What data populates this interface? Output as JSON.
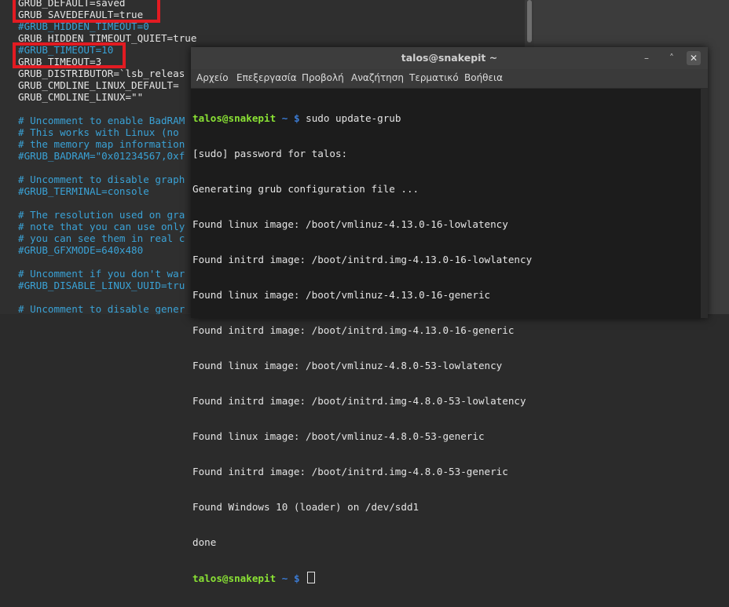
{
  "editor": {
    "lines": [
      {
        "text": "GRUB_DEFAULT=saved",
        "comment": false
      },
      {
        "text": "GRUB_SAVEDEFAULT=true",
        "comment": false
      },
      {
        "text": "#GRUB_HIDDEN_TIMEOUT=0",
        "comment": true
      },
      {
        "text": "GRUB_HIDDEN_TIMEOUT_QUIET=true",
        "comment": false
      },
      {
        "text": "#GRUB_TIMEOUT=10",
        "comment": true
      },
      {
        "text": "GRUB_TIMEOUT=3",
        "comment": false
      },
      {
        "text": "GRUB_DISTRIBUTOR=`lsb_releas",
        "comment": false
      },
      {
        "text": "GRUB_CMDLINE_LINUX_DEFAULT=",
        "comment": false
      },
      {
        "text": "GRUB_CMDLINE_LINUX=\"\"",
        "comment": false
      },
      {
        "text": "",
        "comment": false
      },
      {
        "text": "# Uncomment to enable BadRAM",
        "comment": true
      },
      {
        "text": "# This works with Linux (no",
        "comment": true
      },
      {
        "text": "# the memory map information",
        "comment": true
      },
      {
        "text": "#GRUB_BADRAM=\"0x01234567,0xf",
        "comment": true
      },
      {
        "text": "",
        "comment": false
      },
      {
        "text": "# Uncomment to disable graph",
        "comment": true
      },
      {
        "text": "#GRUB_TERMINAL=console",
        "comment": true
      },
      {
        "text": "",
        "comment": false
      },
      {
        "text": "# The resolution used on gra",
        "comment": true
      },
      {
        "text": "# note that you can use only",
        "comment": true
      },
      {
        "text": "# you can see them in real c",
        "comment": true
      },
      {
        "text": "#GRUB_GFXMODE=640x480",
        "comment": true
      },
      {
        "text": "",
        "comment": false
      },
      {
        "text": "# Uncomment if you don't war",
        "comment": true
      },
      {
        "text": "#GRUB_DISABLE_LINUX_UUID=tru",
        "comment": true
      },
      {
        "text": "",
        "comment": false
      },
      {
        "text": "# Uncomment to disable gener",
        "comment": true
      }
    ]
  },
  "terminal": {
    "title": "talos@snakepit ~",
    "window_buttons": {
      "minimize": "–",
      "maximize": "˄",
      "close": "✕"
    },
    "menu": [
      "Αρχείο",
      "Επεξεργασία",
      "Προβολή",
      "Αναζήτηση",
      "Τερματικό",
      "Βοήθεια"
    ],
    "prompt_user": "talos@snakepit",
    "prompt_path": "~",
    "prompt_symbol": "$",
    "command": "sudo update-grub",
    "output": [
      "[sudo] password for talos:",
      "Generating grub configuration file ...",
      "Found linux image: /boot/vmlinuz-4.13.0-16-lowlatency",
      "Found initrd image: /boot/initrd.img-4.13.0-16-lowlatency",
      "Found linux image: /boot/vmlinuz-4.13.0-16-generic",
      "Found initrd image: /boot/initrd.img-4.13.0-16-generic",
      "Found linux image: /boot/vmlinuz-4.8.0-53-lowlatency",
      "Found initrd image: /boot/initrd.img-4.8.0-53-lowlatency",
      "Found linux image: /boot/vmlinuz-4.8.0-53-generic",
      "Found initrd image: /boot/initrd.img-4.8.0-53-generic",
      "Found Windows 10 (loader) on /dev/sdd1",
      "done"
    ]
  },
  "colors": {
    "highlight_box": "#e21b22",
    "prompt_user": "#8ae234",
    "prompt_path": "#3b7bd4",
    "comment": "#3aa2d6"
  }
}
